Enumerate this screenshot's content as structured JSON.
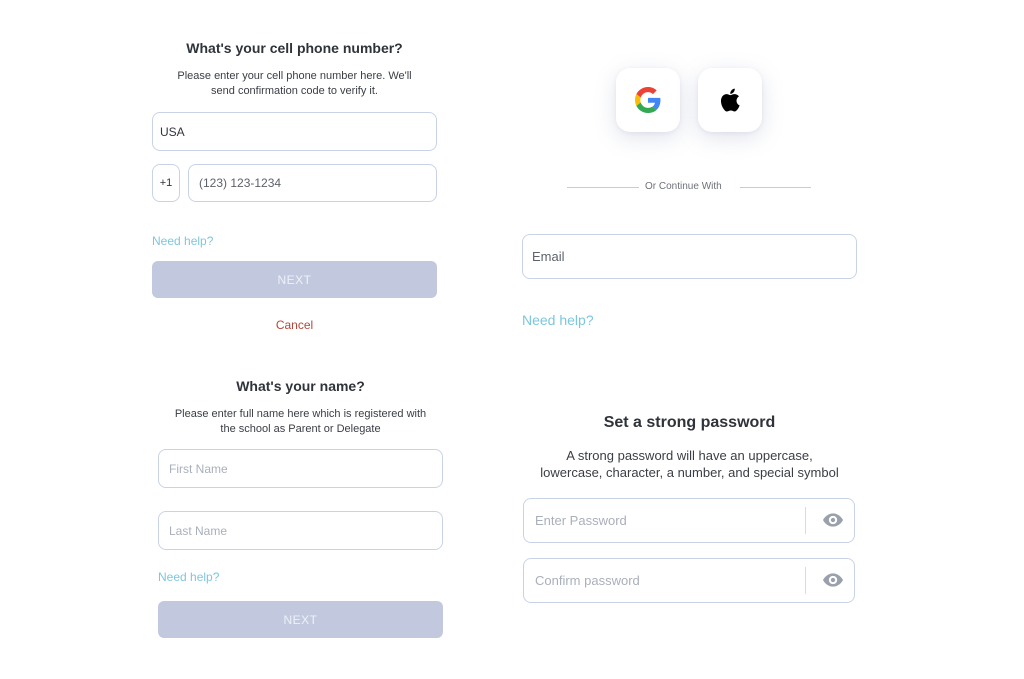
{
  "phone_panel": {
    "title": "What's your cell phone number?",
    "description_line1": "Please enter your cell phone number here. We'll",
    "description_line2": "send confirmation code to verify it.",
    "country_value": "USA",
    "country_code": "+1",
    "phone_placeholder": "(123) 123-1234",
    "help_link": "Need help?",
    "next_label": "NEXT",
    "cancel_label": "Cancel"
  },
  "social_panel": {
    "google_icon": "google-logo-icon",
    "apple_icon": "apple-logo-icon",
    "divider_text": "Or Continue With",
    "email_placeholder": "Email",
    "help_link": "Need help?"
  },
  "name_panel": {
    "title": "What's your name?",
    "description_line1": "Please enter full name here which is registered with",
    "description_line2": "the school as Parent or Delegate",
    "first_name_placeholder": "First Name",
    "last_name_placeholder": "Last Name",
    "help_link": "Need help?",
    "next_label": "NEXT"
  },
  "password_panel": {
    "title": "Set a strong password",
    "description_line1": "A strong password will have an uppercase,",
    "description_line2": "lowercase, character, a number, and special symbol",
    "password_placeholder": "Enter Password",
    "confirm_placeholder": "Confirm password",
    "eye_icon": "eye-icon"
  },
  "colors": {
    "accent_link": "#7cc7dd",
    "button_disabled": "#c2c9df",
    "cancel": "#b2473a",
    "field_border": "#c9d3e6"
  }
}
